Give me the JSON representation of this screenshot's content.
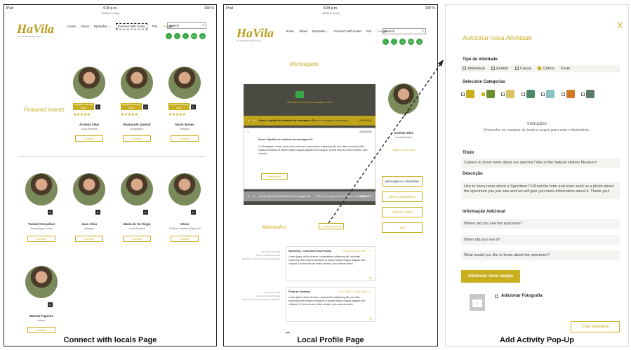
{
  "status": {
    "device": "iPad",
    "time": "4:28 p.m.",
    "url": "havila.m-ti.org",
    "battery": "100 %"
  },
  "logo": {
    "name": "HaVila",
    "tagline": "A Comunidade Biológica"
  },
  "nav": {
    "items": [
      "Home",
      "About",
      "Episodes ⌄",
      "Connect with locals",
      "PoL"
    ],
    "login": "Login",
    "search_placeholder": "Search"
  },
  "social": [
    "i",
    "f",
    "t",
    "G+",
    "y"
  ],
  "page1": {
    "featured": "Featured events",
    "soon": "Activities coming soon",
    "connect": "Connect",
    "people": [
      {
        "name": "Arsénia Silva",
        "role": "Local Resident",
        "stars": "★★★★★"
      },
      {
        "name": "Raimundo Quintal",
        "role": "Geographer",
        "stars": "★★★★★"
      },
      {
        "name": "Marta Nunes",
        "role": "Biologist",
        "stars": "★★★★★"
      },
      {
        "name": "Ysabel Gonçalves",
        "role": "Entomology Curator"
      },
      {
        "name": "Juan Silva",
        "role": "Biologist"
      },
      {
        "name": "Maria de Sá Diogo",
        "role": "Local Resident"
      },
      {
        "name": "Sónia",
        "role": "Guide at Calheta's Sugar mill"
      },
      {
        "name": "Manuel Figueira",
        "role": "Artisan"
      }
    ],
    "caption": "Connect with locals Page"
  },
  "page2": {
    "messages_title": "Mensagens",
    "banner": "Olá Arsénia! Veja teus mensagens novas",
    "msg1_head": "Nome e Apelido do remitente da mensagem #1",
    "msg1_preview": "Texto e mensagem a mensagem...",
    "msg1_date": "19/09/2016",
    "msg2_date": "19/09/2016",
    "msg2_head": "Nome e Apelido do remitente da mensagem #2",
    "msg2_body": "Lê Mensagem: Lorem ipsum dolor sit amet, consectetuer adipiscing elit, sed diam nonummy nibh euismod tincidunt ut laoreet dolore magna aliquam erat volutpat. Ut wisi enim ad minim veniam, quis nostrud.",
    "reply": "Responder",
    "msg3_head": "Nome e Apelido do remitente da mensagem #3",
    "msg3_preview": "Texto e mensagem de mensagem a mensagem...",
    "msg3_date": "19/09/2016",
    "profile_name": "Arsénia Silva",
    "profile_role": "Local Resident",
    "edit_profile": "Editar o meu perfil",
    "side_buttons": [
      "Mensagens e Atividades",
      "Meus Comentários",
      "Vídeos e Fotos",
      "Sair"
    ],
    "activities_title": "Atividades",
    "new_activity": "+ Adicionar nova",
    "activities": [
      {
        "date": "Dezembro 10, 2016",
        "place": "Monte | Funchal Portugal",
        "meta": "Workshop, Biomata, Ecológia e Botânica",
        "title": "Workshop - Como fazer uma Ponchα",
        "time": "10:00-2016 às 17:00",
        "body": "Lorem ipsum dolor sit amet, consectetuer adipiscing elit, sed diam nonummy nibh euismod tincidunt ut laoreet dolore magna aliquam erat volutpat. Ut wisi enim ad minim veniam, quis nostrud exerci."
      },
      {
        "date": "Outubro 15, 2016",
        "place": "Monte | Funchal Portugal",
        "meta": "Workshop, Biomata, Ecológia e Botânica",
        "title": "Festa da Castanha",
        "time": "11:00-2016 · 14 Nov 2016",
        "body": "Lorem ipsum dolor sit amet, consectetuer adipiscing elit, sed diam nonummy nibh euismod tincidunt ut laoreet dolore magna aliquam erat volutpat. Ut wisi enim ad minim veniam, quis nostrud exerci."
      }
    ],
    "caption": "Local Profile Page"
  },
  "page3": {
    "title": "Adicionar nova Atividade",
    "close": "X",
    "type_label": "Tipo de Atividade",
    "types": [
      "Workshop",
      "Evento",
      "Causa",
      "Outros"
    ],
    "form_word": "Form",
    "categories_label": "Selecione Categorias",
    "instructions_title": "Instruções",
    "instructions_text": "Preenche os campos de texto a seguir para criar o formulário.",
    "titulo_label": "Título",
    "titulo_value": "Curious to know more about our species? Ask to the Natural History Museum!",
    "descricao_label": "Descrição",
    "descricao_value": "Like to know more about a Specimen? Fill out the form and even send us a photo about the specimen you just saw and we will give you more information about it. Thank you!",
    "info_label": "Informação Adicional",
    "questions": [
      "Where did you see the specimen?",
      "When did you see it?",
      "What would you like to know about the specimen?"
    ],
    "add_field": "Adicionar novo campo",
    "add_photo": "Adicionar Fotografia",
    "create": "Criar atividade",
    "caption": "Add Activity Pop-Up"
  },
  "colors": {
    "gold": "#c9ae1e",
    "dark_box": "#4a4a42",
    "green_social": "#3aa845"
  }
}
